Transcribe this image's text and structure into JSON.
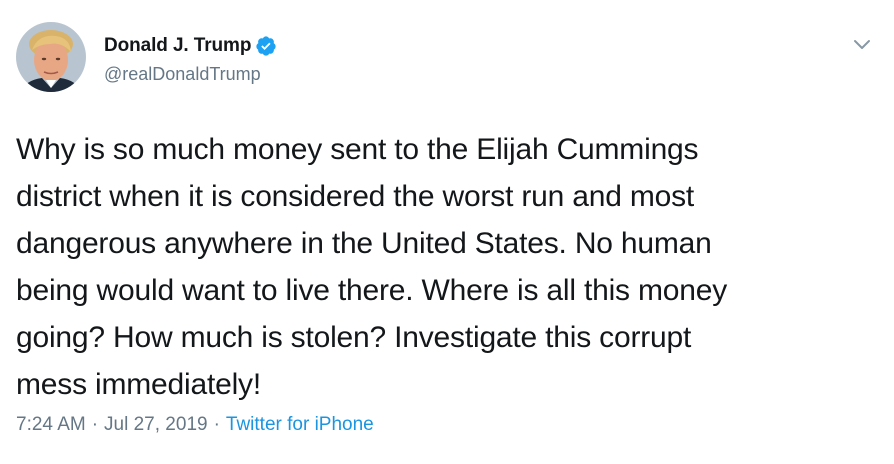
{
  "user": {
    "display_name": "Donald J. Trump",
    "handle": "@realDonaldTrump",
    "verified": true,
    "avatar_icon": "profile-photo",
    "verified_icon": "verified-badge-icon",
    "verified_color": "#1da1f2"
  },
  "tweet": {
    "lines": [
      "Why is so much money sent to the Elijah Cummings",
      "district when it is considered the worst run and most",
      "dangerous anywhere in the United States. No human",
      "being would want to live there. Where is all this money",
      "going? How much is stolen? Investigate this corrupt",
      "mess immediately!"
    ]
  },
  "meta": {
    "time": "7:24 AM",
    "separator": "·",
    "date": "Jul 27, 2019",
    "source": "Twitter for iPhone",
    "source_color": "#1b95e0"
  },
  "menu": {
    "icon": "chevron-down-icon"
  }
}
